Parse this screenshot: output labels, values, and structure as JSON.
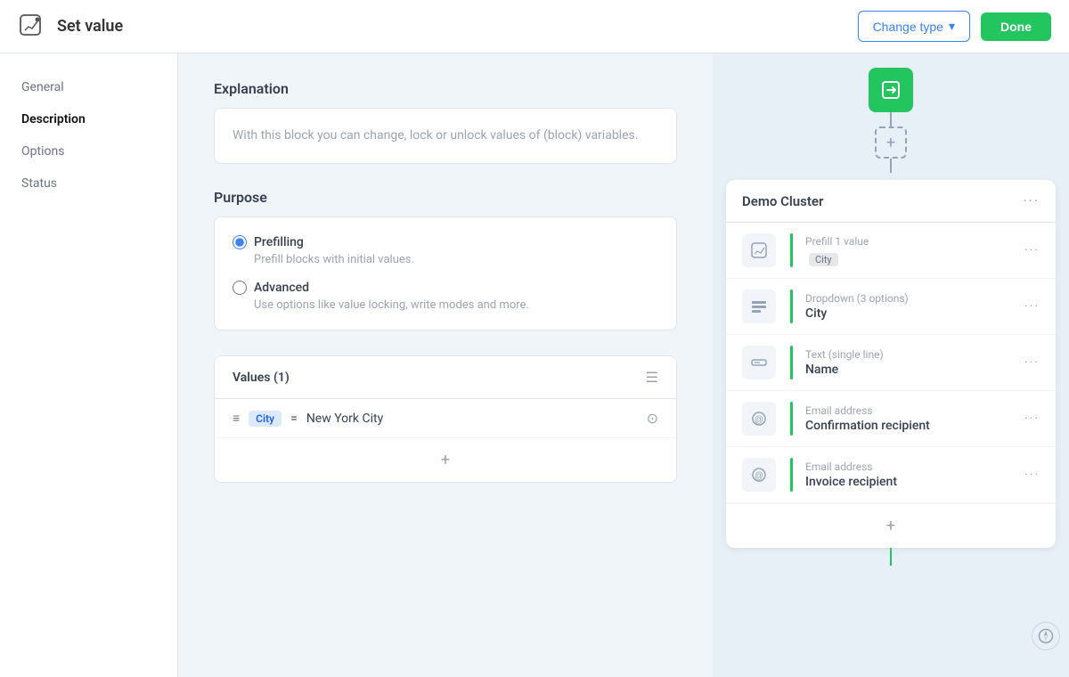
{
  "header": {
    "icon": "✏",
    "title": "Set value",
    "change_type_label": "Change type",
    "done_label": "Done"
  },
  "sidebar": {
    "items": [
      {
        "label": "General",
        "active": false
      },
      {
        "label": "Description",
        "active": true
      },
      {
        "label": "Options",
        "active": false
      },
      {
        "label": "Status",
        "active": false
      }
    ]
  },
  "content": {
    "explanation_title": "Explanation",
    "explanation_text": "With this block you can change, lock or unlock values of (block) variables.",
    "purpose_title": "Purpose",
    "purpose_options": [
      {
        "label": "Prefilling",
        "desc": "Prefill blocks with initial values.",
        "checked": true
      },
      {
        "label": "Advanced",
        "desc": "Use options like value locking, write modes and more.",
        "checked": false
      }
    ],
    "values_title": "Values (1)",
    "value_row": {
      "tag": "City",
      "equals": "=",
      "value": "New York City"
    },
    "add_value_icon": "+"
  },
  "right_panel": {
    "cluster_title": "Demo Cluster",
    "cluster_items": [
      {
        "type": "Prefill 1 value",
        "name": "",
        "badge": "City",
        "icon": "edit"
      },
      {
        "type": "Dropdown (3 options)",
        "name": "City",
        "badge": "",
        "icon": "list"
      },
      {
        "type": "Text (single line)",
        "name": "Name",
        "badge": "",
        "icon": "textfield"
      },
      {
        "type": "Email address",
        "name": "Confirmation recipient",
        "badge": "",
        "icon": "at"
      },
      {
        "type": "Email address",
        "name": "Invoice recipient",
        "badge": "",
        "icon": "at"
      }
    ]
  }
}
